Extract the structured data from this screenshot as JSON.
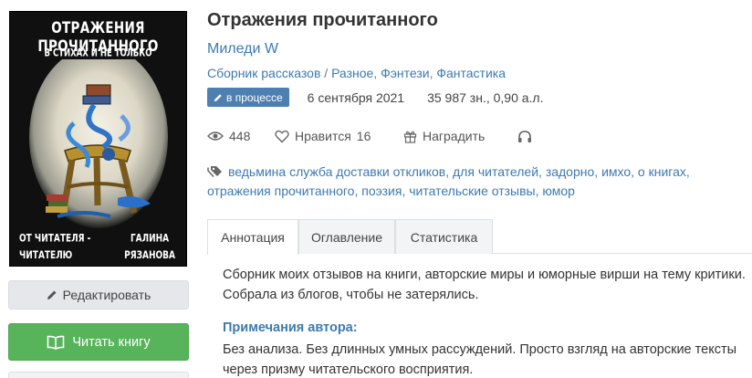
{
  "cover": {
    "title": "ОТРАЖЕНИЯ ПРОЧИТАННОГО",
    "subtitle": "В СТИХАХ И НЕ ТОЛЬКО",
    "left_line1": "ОТ ЧИТАТЕЛЯ -",
    "left_line2": "ЧИТАТЕЛЮ",
    "right_line1": "ГАЛИНА",
    "right_line2": "РЯЗАНОВА"
  },
  "buttons": {
    "edit_label": "Редактировать",
    "read_label": "Читать книгу"
  },
  "book": {
    "title": "Отражения прочитанного",
    "author": "Миледи W",
    "genre_1": "Сборник рассказов",
    "genre_sep_1": " / ",
    "genre_2": "Разное",
    "genre_sep_2": ", ",
    "genre_3": "Фэнтези",
    "genre_sep_3": ", ",
    "genre_4": "Фантастика"
  },
  "meta": {
    "status": "в процессе",
    "date": "6 сентября 2021",
    "size": "35 987 зн., 0,90 а.л."
  },
  "stats": {
    "views": "448",
    "likes_label": "Нравится",
    "likes_count": "16",
    "reward_label": "Наградить"
  },
  "tags": [
    "ведьмина служба доставки откликов",
    "для читателей",
    "задорно",
    "имхо",
    "о книгах",
    "отражения прочитанного",
    "поэзия",
    "читательские отзывы",
    "юмор"
  ],
  "tabs": [
    "Аннотация",
    "Оглавление",
    "Статистика"
  ],
  "annotation": "Сборник моих отзывов на книги, авторские миры и юморные вирши на тему критики. Собрала из блогов, чтобы не затерялись.",
  "notes": {
    "title": "Примечания автора:",
    "text": "Без анализа. Без длинных умных рассуждений. Просто взгляд на авторские тексты через призму читательского восприятия."
  },
  "colors": {
    "link": "#3d7ab0",
    "badge": "#4d7fb1",
    "read_button": "#57b45b"
  }
}
